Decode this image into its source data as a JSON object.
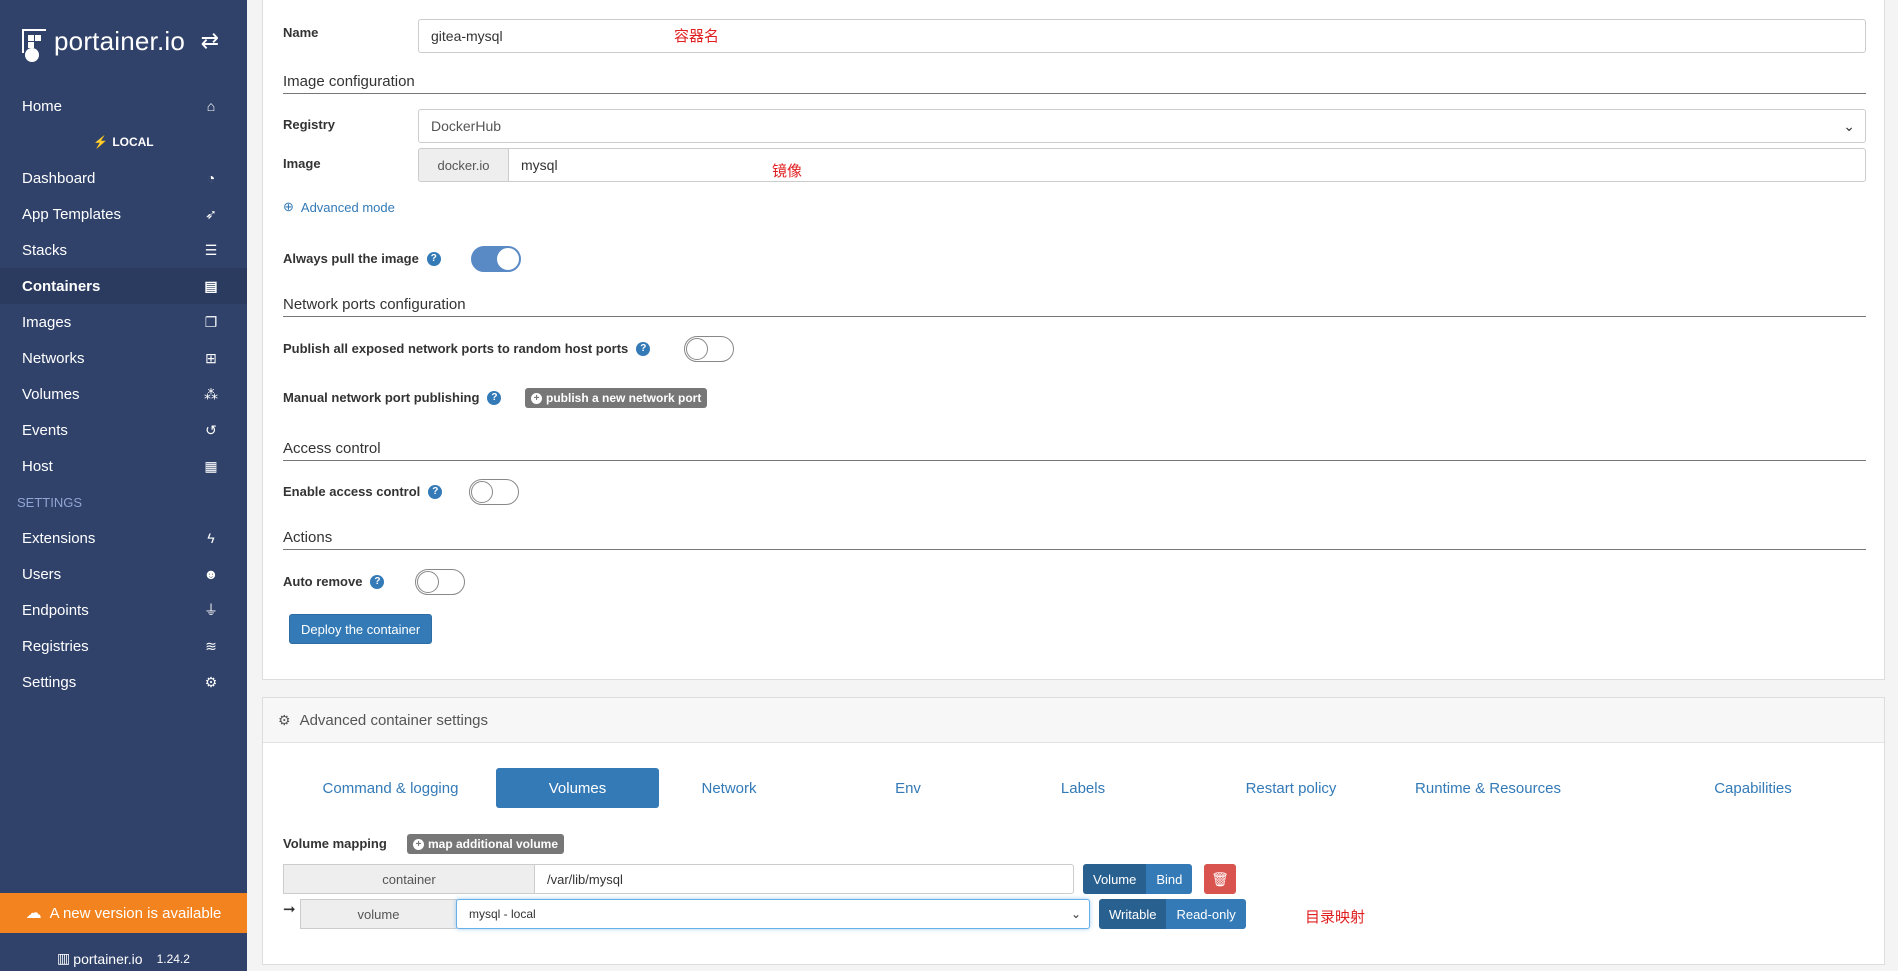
{
  "sidebar": {
    "logo": "portainer.io",
    "home": "Home",
    "endpoint_label": "LOCAL",
    "items": [
      "Dashboard",
      "App Templates",
      "Stacks",
      "Containers",
      "Images",
      "Networks",
      "Volumes",
      "Events",
      "Host"
    ],
    "settings_heading": "SETTINGS",
    "settings_items": [
      "Extensions",
      "Users",
      "Endpoints",
      "Registries",
      "Settings"
    ],
    "update_notice": "A new version is available",
    "footer_logo": "portainer.io",
    "version": "1.24.2"
  },
  "form": {
    "name_label": "Name",
    "name_value": "gitea-mysql",
    "name_annotation": "容器名",
    "image_config_title": "Image configuration",
    "registry_label": "Registry",
    "registry_value": "DockerHub",
    "image_label": "Image",
    "image_prefix": "docker.io",
    "image_value": "mysql",
    "image_annotation": "镜像",
    "advanced_mode": "Advanced mode",
    "always_pull_label": "Always pull the image",
    "network_ports_title": "Network ports configuration",
    "publish_all_label": "Publish all exposed network ports to random host ports",
    "manual_publish_label": "Manual network port publishing",
    "publish_new_port": "publish a new network port",
    "access_control_title": "Access control",
    "enable_access_label": "Enable access control",
    "actions_title": "Actions",
    "auto_remove_label": "Auto remove",
    "deploy_button": "Deploy the container"
  },
  "advanced": {
    "title": "Advanced container settings",
    "tabs": [
      "Command & logging",
      "Volumes",
      "Network",
      "Env",
      "Labels",
      "Restart policy",
      "Runtime & Resources",
      "Capabilities"
    ],
    "volume_mapping_label": "Volume mapping",
    "map_additional": "map additional volume",
    "container_label": "container",
    "container_path": "/var/lib/mysql",
    "type_volume": "Volume",
    "type_bind": "Bind",
    "volume_label": "volume",
    "volume_select": "mysql - local",
    "writable": "Writable",
    "readonly": "Read-only",
    "mapping_annotation": "目录映射"
  }
}
